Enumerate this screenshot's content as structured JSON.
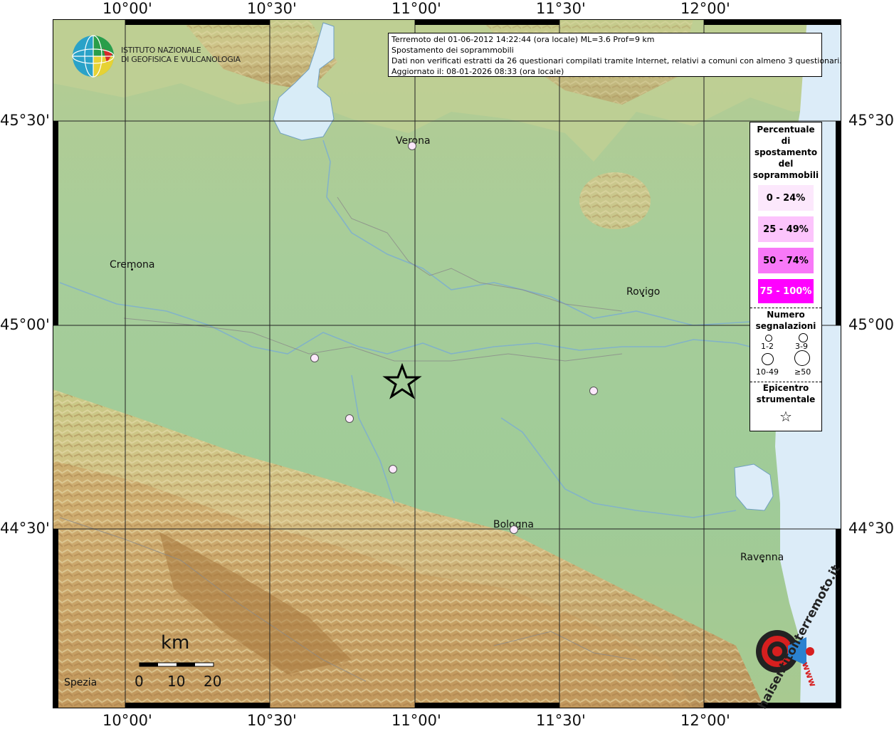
{
  "info": {
    "line1": "Terremoto del 01-06-2012 14:22:44 (ora locale) ML=3.6 Prof=9 km",
    "line2": "Spostamento dei soprammobili",
    "line3": "Dati non verificati estratti da 26 questionari compilati tramite Internet, relativi a comuni con almeno 3 questionari.",
    "line4": "Aggiornato il: 08-01-2026 08:33 (ora locale)"
  },
  "logo": {
    "line1": "ISTITUTO NAZIONALE",
    "line2": "DI GEOFISICA E VULCANOLOGIA"
  },
  "axes": {
    "lon_top": [
      "10°00'",
      "10°30'",
      "11°00'",
      "11°30'",
      "12°00'"
    ],
    "lon_bottom": [
      "10°00'",
      "10°30'",
      "11°00'",
      "11°30'",
      "12°00'"
    ],
    "lat_left": [
      "45°30'",
      "45°00'",
      "44°30'"
    ],
    "lat_right": [
      "45°30'",
      "45°00'",
      "44°30'"
    ]
  },
  "cities": {
    "verona": "Verona",
    "cremona": "Cremona",
    "rovigo": "Rovigo",
    "bologna": "Bologna",
    "ravenna": "Ravenna",
    "spezia": "Spezia"
  },
  "legend": {
    "title": [
      "Percentuale",
      "di",
      "spostamento",
      "del",
      "soprammobili"
    ],
    "classes": [
      {
        "label": "0 - 24%",
        "color": "#fce8fc",
        "text_color": "#000000"
      },
      {
        "label": "25 - 49%",
        "color": "#fcc4fc",
        "text_color": "#000000"
      },
      {
        "label": "50 - 74%",
        "color": "#f878f8",
        "text_color": "#000000"
      },
      {
        "label": "75 - 100%",
        "color": "#ff00ff",
        "text_color": "#ffffff"
      }
    ],
    "count_title": [
      "Numero",
      "segnalazioni"
    ],
    "count_labels": [
      "1-2",
      "3-9",
      "10-49",
      "≥50"
    ],
    "epicenter_title": [
      "Epicentro",
      "strumentale"
    ]
  },
  "scale": {
    "title": "km",
    "ticks": [
      "0",
      "10",
      "20"
    ]
  },
  "hst_logo": {
    "text": "haisentitoilterremoto.it",
    "url": "www"
  },
  "colors": {
    "plain": "#9fc89a",
    "hills": "#d8cc8a",
    "mountain": "#b98a4c",
    "water": "#cfe6f5",
    "grid": "#222222"
  }
}
